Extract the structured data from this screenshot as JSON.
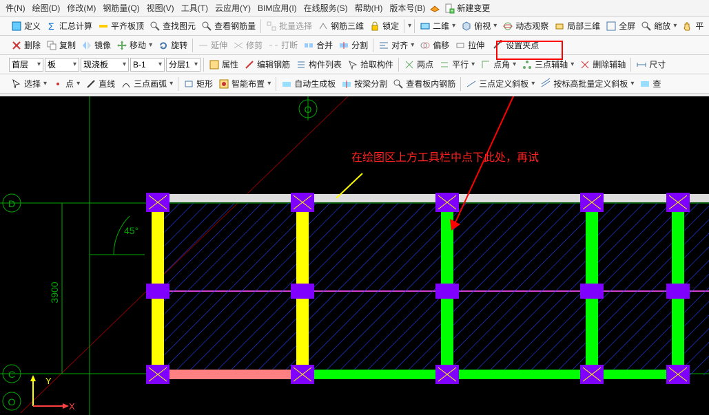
{
  "menubar": {
    "items": [
      "件(N)",
      "绘图(D)",
      "修改(M)",
      "钢筋量(Q)",
      "视图(V)",
      "工具(T)",
      "云应用(Y)",
      "BIM应用(I)",
      "在线服务(S)",
      "帮助(H)",
      "版本号(B)"
    ],
    "extra": "新建变更"
  },
  "tb1": {
    "define": "定义",
    "sum": "汇总计算",
    "flat": "平齐板顶",
    "find": "查找图元",
    "steel": "查看钢筋量",
    "batch": "批量选择",
    "steel3d": "钢筋三维",
    "lock": "锁定",
    "view2d": "二维",
    "top": "俯视",
    "dyn": "动态观察",
    "local3d": "局部三维",
    "full": "全屏",
    "zoom": "缩放",
    "pan": "平"
  },
  "tb2": {
    "del": "删除",
    "copy": "复制",
    "mirror": "镜像",
    "move": "移动",
    "rotate": "旋转",
    "extend": "延伸",
    "trim": "修剪",
    "break": "打断",
    "merge": "合并",
    "split": "分割",
    "align": "对齐",
    "offset": "偏移",
    "stretch": "拉伸",
    "setgrip": "设置夹点"
  },
  "tb3": {
    "floor": "首层",
    "slab": "板",
    "cast": "现浇板",
    "b1": "B-1",
    "layer": "分层1",
    "prop": "属性",
    "editsteel": "编辑钢筋",
    "list": "构件列表",
    "pick": "拾取构件",
    "two": "两点",
    "para": "平行",
    "corner": "点角",
    "threeaux": "三点辅轴",
    "delaux": "删除辅轴",
    "dims": "尺寸"
  },
  "tb4": {
    "select": "选择",
    "point": "点",
    "line": "直线",
    "arc3": "三点画弧",
    "rect": "矩形",
    "smart": "智能布置",
    "autogen": "自动生成板",
    "beam": "按梁分割",
    "inslab": "查看板内钢筋",
    "tilt3": "三点定义斜板",
    "tilt": "按标高批量定义斜板",
    "view": "查"
  },
  "anno": "在绘图区上方工具栏中点下此处，再试",
  "labels": {
    "O": "O",
    "C": "C",
    "D": "D",
    "angle": "45°",
    "dim": "3900",
    "X": "X",
    "Y": "Y"
  }
}
